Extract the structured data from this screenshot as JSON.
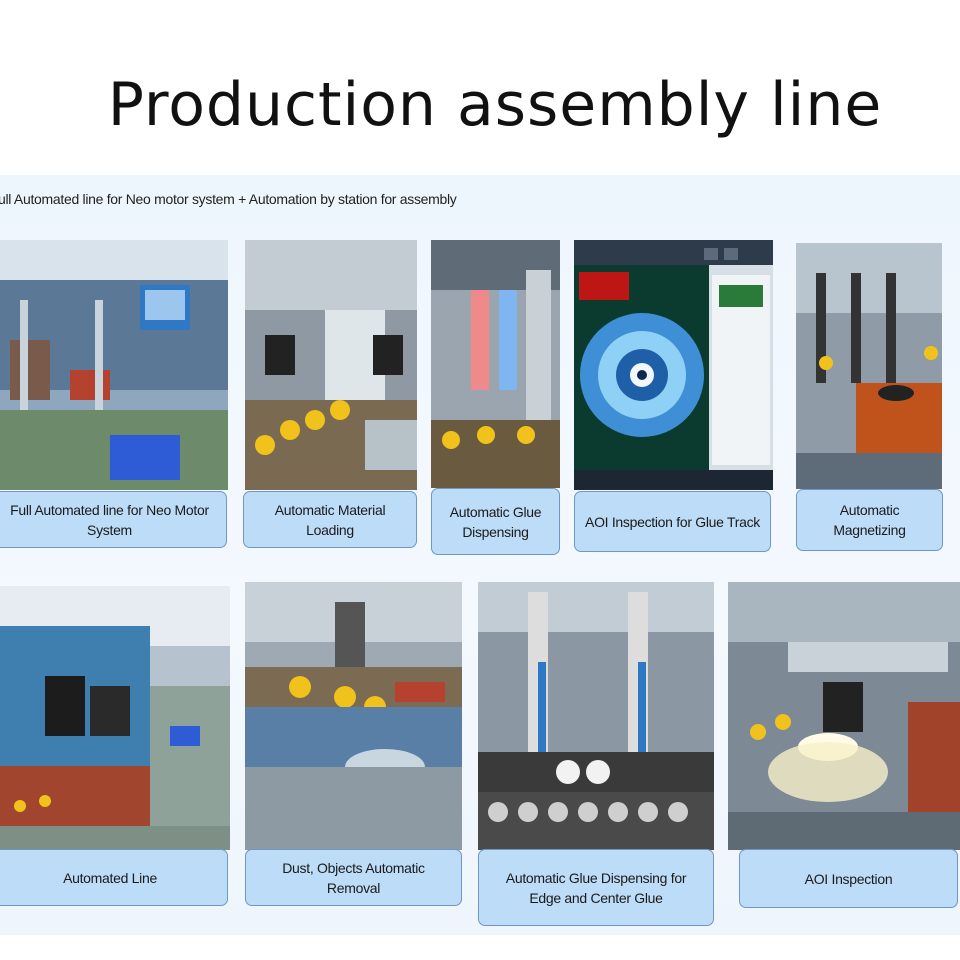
{
  "title": "Production assembly line",
  "subtitle": "ull Automated line for Neo motor system + Automation by station for assembly",
  "row1": [
    {
      "caption": "Full Automated line for Neo Motor System"
    },
    {
      "caption": "Automatic Material Loading"
    },
    {
      "caption": "Automatic Glue Dispensing"
    },
    {
      "caption": "AOI Inspection for Glue Track"
    },
    {
      "caption": "Automatic Magnetizing"
    }
  ],
  "row2": [
    {
      "caption": "Automated Line"
    },
    {
      "caption": "Dust, Objects Automatic Removal"
    },
    {
      "caption": "Automatic Glue Dispensing for Edge and Center Glue"
    },
    {
      "caption": "AOI Inspection"
    }
  ],
  "colors": {
    "caption_fill": "#bcdcf7",
    "caption_border": "#6e98c3",
    "panel_bg": "#eef6fd"
  }
}
